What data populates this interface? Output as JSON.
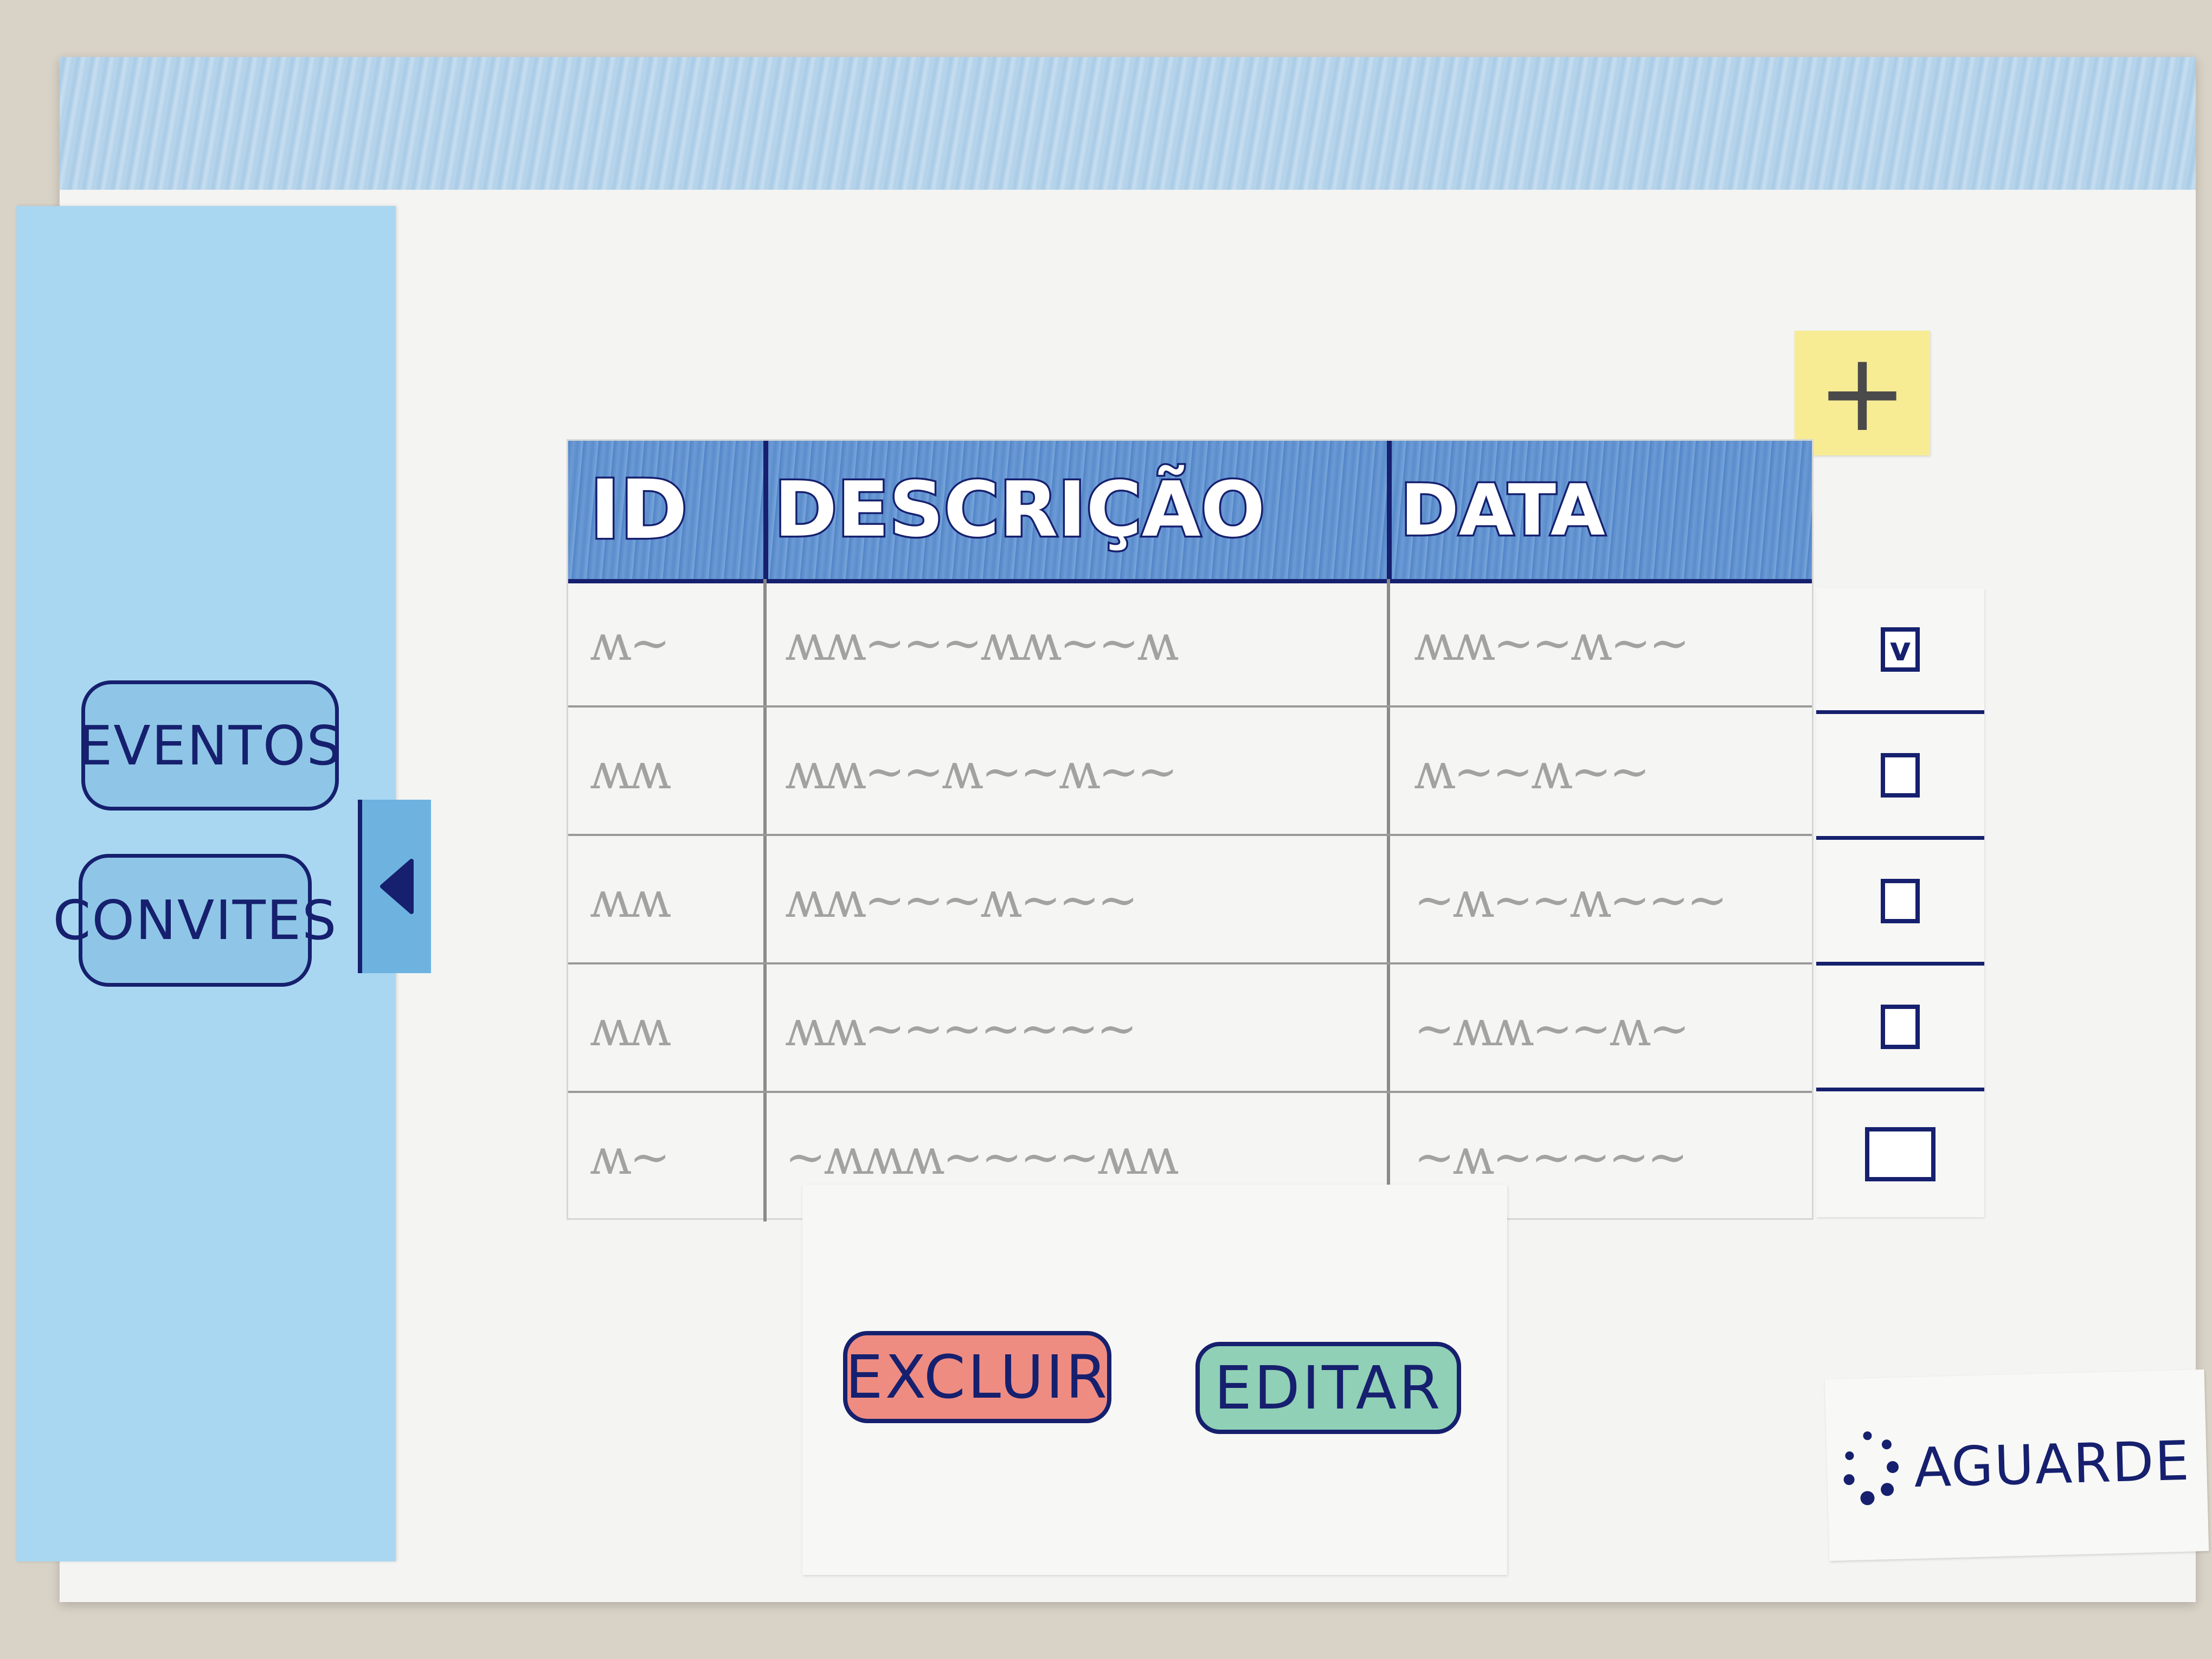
{
  "sidebar": {
    "items": [
      {
        "label": "EVENTOS"
      },
      {
        "label": "CONVITES"
      }
    ],
    "collapse_icon": "triangle-left-icon"
  },
  "toolbar": {
    "add_label": "+"
  },
  "table": {
    "headers": [
      "ID",
      "DESCRIÇÃO",
      "DATA"
    ],
    "rows": [
      {
        "id": "ʍ~",
        "desc": "ʍʍ~~~ʍʍ~~ʍ",
        "data": "ʍʍ~~ʍ~~"
      },
      {
        "id": "ʍʍ",
        "desc": "ʍʍ~~ʍ~~ʍ~~",
        "data": "ʍ~~ʍ~~"
      },
      {
        "id": "ʍʍ",
        "desc": "ʍʍ~~~ʍ~~~",
        "data": "~ʍ~~ʍ~~~"
      },
      {
        "id": "ʍʍ",
        "desc": "ʍʍ~~~~~~~",
        "data": "~ʍʍ~~ʍ~"
      },
      {
        "id": "ʍ~",
        "desc": "~ʍʍʍ~~~~ʍʍ",
        "data": "~ʍ~~~~~"
      }
    ]
  },
  "checks": [
    {
      "checked": true,
      "mark": "v"
    },
    {
      "checked": false,
      "mark": ""
    },
    {
      "checked": false,
      "mark": ""
    },
    {
      "checked": false,
      "mark": ""
    },
    {
      "checked": false,
      "mark": ""
    }
  ],
  "actions": {
    "delete_label": "EXCLUIR",
    "edit_label": "EDITAR"
  },
  "status": {
    "text": "AGUARDE",
    "icon": "loading-spinner-icon"
  },
  "colors": {
    "header_blue": "#5a8dcd",
    "sidebar_blue": "#a9d7f1",
    "ink": "#16206e",
    "delete_red": "#ef8c82",
    "edit_green": "#8fd0b6",
    "add_yellow": "#f7ec94"
  }
}
